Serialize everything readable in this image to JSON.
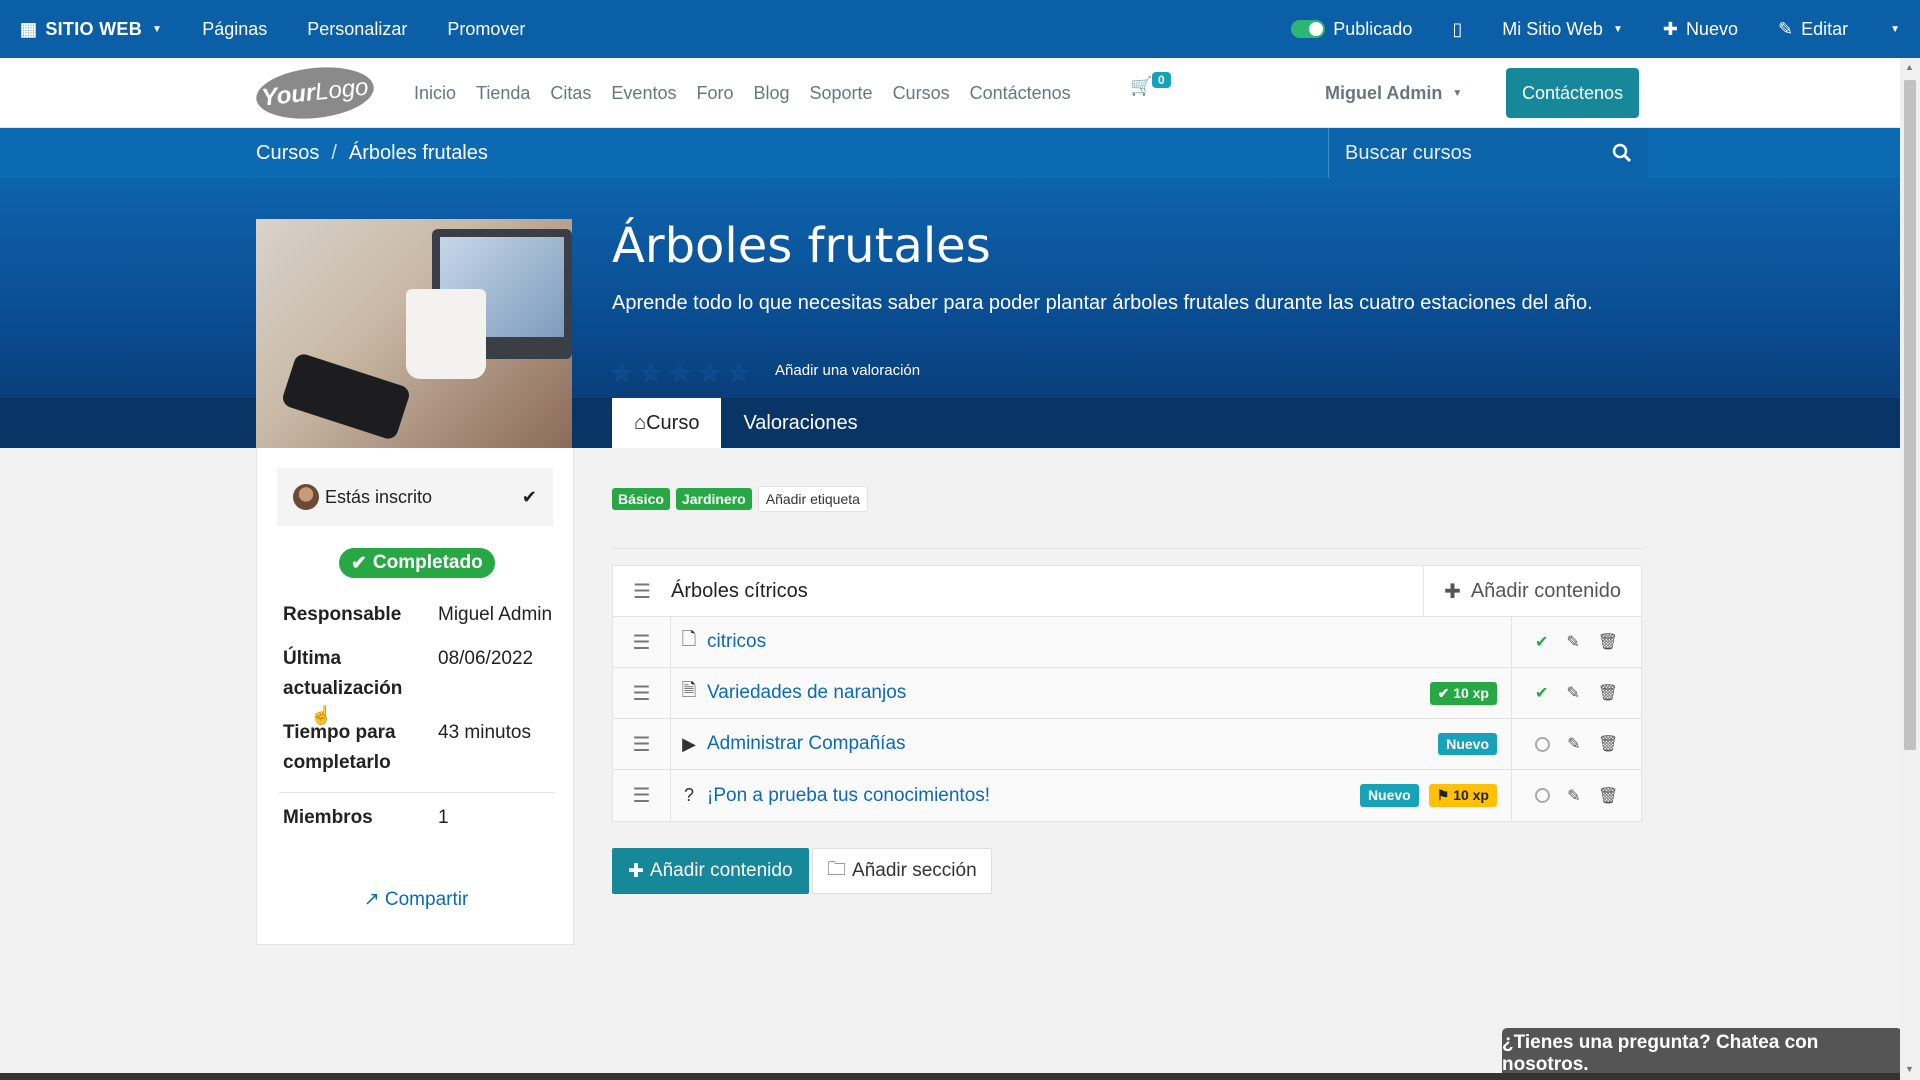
{
  "adminbar": {
    "brand": "SITIO WEB",
    "items": [
      "Páginas",
      "Personalizar",
      "Promover"
    ],
    "published": "Publicado",
    "website": "Mi Sitio Web",
    "new": "Nuevo",
    "edit": "Editar"
  },
  "header": {
    "logo_bold": "Your",
    "logo_thin": "Logo",
    "nav": [
      "Inicio",
      "Tienda",
      "Citas",
      "Eventos",
      "Foro",
      "Blog",
      "Soporte",
      "Cursos",
      "Contáctenos"
    ],
    "cart_count": "0",
    "user": "Miguel Admin",
    "contact_button": "Contáctenos"
  },
  "breadcrumb": {
    "root": "Cursos",
    "current": "Árboles frutales"
  },
  "search": {
    "placeholder": "Buscar cursos"
  },
  "course": {
    "title": "Árboles frutales",
    "subtitle": "Aprende todo lo que necesitas saber para poder plantar árboles frutales durante las cuatro estaciones del año.",
    "rating": 0,
    "add_rating": "Añadir una valoración",
    "tabs": [
      "Curso",
      "Valoraciones"
    ]
  },
  "sidebar": {
    "enrolled": "Estás inscrito",
    "completed": "Completado",
    "stats": [
      {
        "k": "Responsable",
        "v": "Miguel Admin"
      },
      {
        "k": "Última actualización",
        "v": "08/06/2022"
      },
      {
        "k": "Tiempo para completarlo",
        "v": "43 minutos"
      },
      {
        "k": "Miembros",
        "v": "1"
      }
    ],
    "share": "Compartir"
  },
  "tags": [
    "Básico",
    "Jardinero"
  ],
  "add_tag": "Añadir etiqueta",
  "section": {
    "title": "Árboles cítricos",
    "add_content": "Añadir contenido",
    "rows": [
      {
        "name": "citricos",
        "icon": "pdf-icon",
        "badges": [],
        "done": true
      },
      {
        "name": "Variedades de naranjos",
        "icon": "document-icon",
        "badges": [
          {
            "type": "xp-done",
            "label": "10 xp"
          }
        ],
        "done": true
      },
      {
        "name": "Administrar Compañías",
        "icon": "video-icon",
        "badges": [
          {
            "type": "new",
            "label": "Nuevo"
          }
        ],
        "done": false
      },
      {
        "name": "¡Pon a prueba tus conocimientos!",
        "icon": "quiz-icon",
        "badges": [
          {
            "type": "new",
            "label": "Nuevo"
          },
          {
            "type": "xp-flag",
            "label": "10 xp"
          }
        ],
        "done": false
      }
    ]
  },
  "buttons": {
    "add_content": "Añadir contenido",
    "add_section": "Añadir sección"
  },
  "chat": "¿Tienes una pregunta? Chatea con nosotros."
}
